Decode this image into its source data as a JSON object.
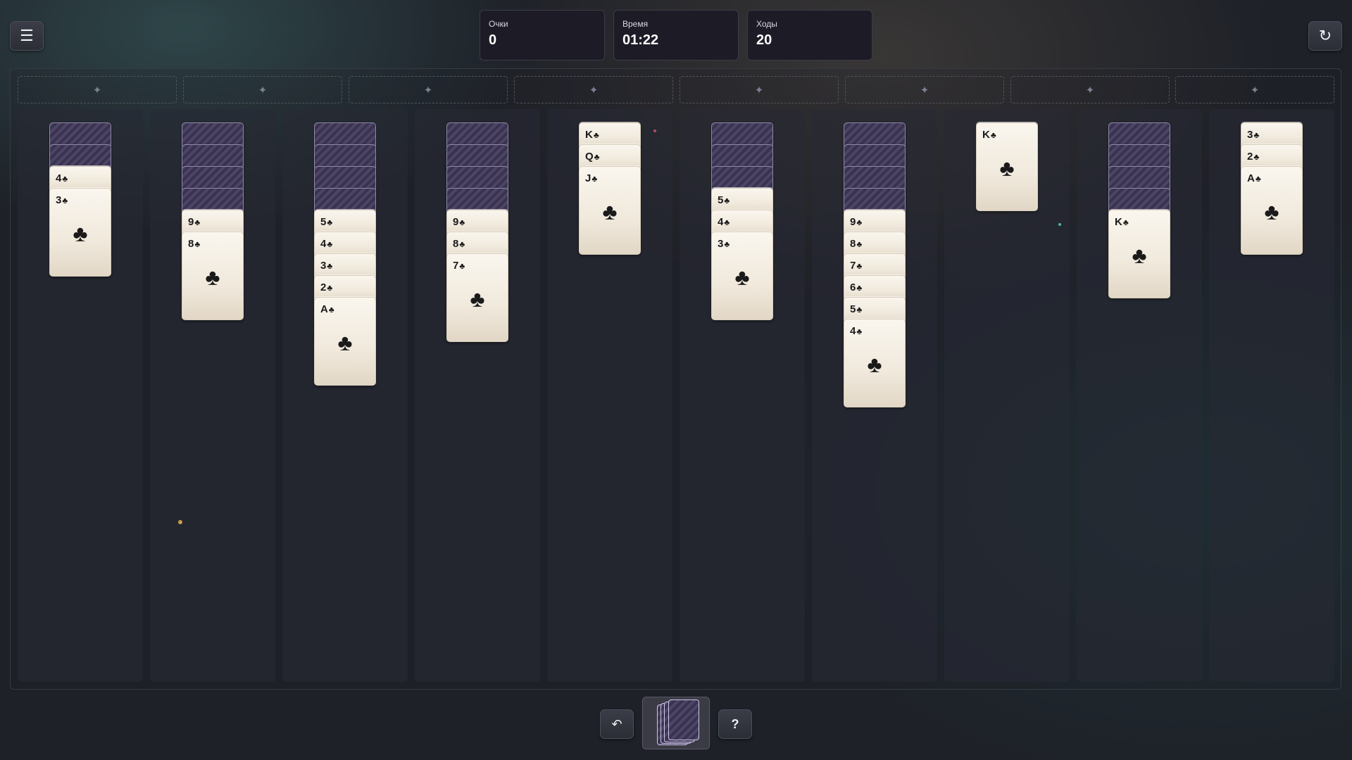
{
  "header": {
    "menu_icon": "hamburger-menu-icon",
    "restart_icon": "restart-icon",
    "stats": [
      {
        "label": "Очки",
        "value": "0"
      },
      {
        "label": "Время",
        "value": "01:22"
      },
      {
        "label": "Ходы",
        "value": "20"
      }
    ]
  },
  "foundations": {
    "count": 8,
    "placeholder_glyph": "✦"
  },
  "suit": "♣",
  "tableau": [
    {
      "face_down": 2,
      "face_up": [
        {
          "rank": "4",
          "suit": "♣"
        },
        {
          "rank": "3",
          "suit": "♣"
        }
      ]
    },
    {
      "face_down": 4,
      "face_up": [
        {
          "rank": "9",
          "suit": "♣"
        },
        {
          "rank": "8",
          "suit": "♣"
        }
      ]
    },
    {
      "face_down": 4,
      "face_up": [
        {
          "rank": "5",
          "suit": "♣"
        },
        {
          "rank": "4",
          "suit": "♣"
        },
        {
          "rank": "3",
          "suit": "♣"
        },
        {
          "rank": "2",
          "suit": "♣"
        },
        {
          "rank": "A",
          "suit": "♣"
        }
      ]
    },
    {
      "face_down": 4,
      "face_up": [
        {
          "rank": "9",
          "suit": "♣"
        },
        {
          "rank": "8",
          "suit": "♣"
        },
        {
          "rank": "7",
          "suit": "♣"
        }
      ]
    },
    {
      "face_down": 0,
      "face_up": [
        {
          "rank": "K",
          "suit": "♣"
        },
        {
          "rank": "Q",
          "suit": "♣"
        },
        {
          "rank": "J",
          "suit": "♣"
        }
      ]
    },
    {
      "face_down": 3,
      "face_up": [
        {
          "rank": "5",
          "suit": "♣"
        },
        {
          "rank": "4",
          "suit": "♣"
        },
        {
          "rank": "3",
          "suit": "♣"
        }
      ]
    },
    {
      "face_down": 4,
      "face_up": [
        {
          "rank": "9",
          "suit": "♣"
        },
        {
          "rank": "8",
          "suit": "♣"
        },
        {
          "rank": "7",
          "suit": "♣"
        },
        {
          "rank": "6",
          "suit": "♣"
        },
        {
          "rank": "5",
          "suit": "♣"
        },
        {
          "rank": "4",
          "suit": "♣"
        }
      ]
    },
    {
      "face_down": 0,
      "face_up": [
        {
          "rank": "K",
          "suit": "♣"
        }
      ]
    },
    {
      "face_down": 4,
      "face_up": [
        {
          "rank": "K",
          "suit": "♣"
        }
      ]
    },
    {
      "face_down": 0,
      "face_up": [
        {
          "rank": "3",
          "suit": "♣"
        },
        {
          "rank": "2",
          "suit": "♣"
        },
        {
          "rank": "A",
          "suit": "♣"
        }
      ]
    }
  ],
  "footer": {
    "undo_icon": "undo-icon",
    "stock_icon": "card-stock-icon",
    "hint_label": "?"
  },
  "colors": {
    "background": "#1e2128",
    "card_face": "#f4eee3",
    "card_back": "#453d5c"
  }
}
